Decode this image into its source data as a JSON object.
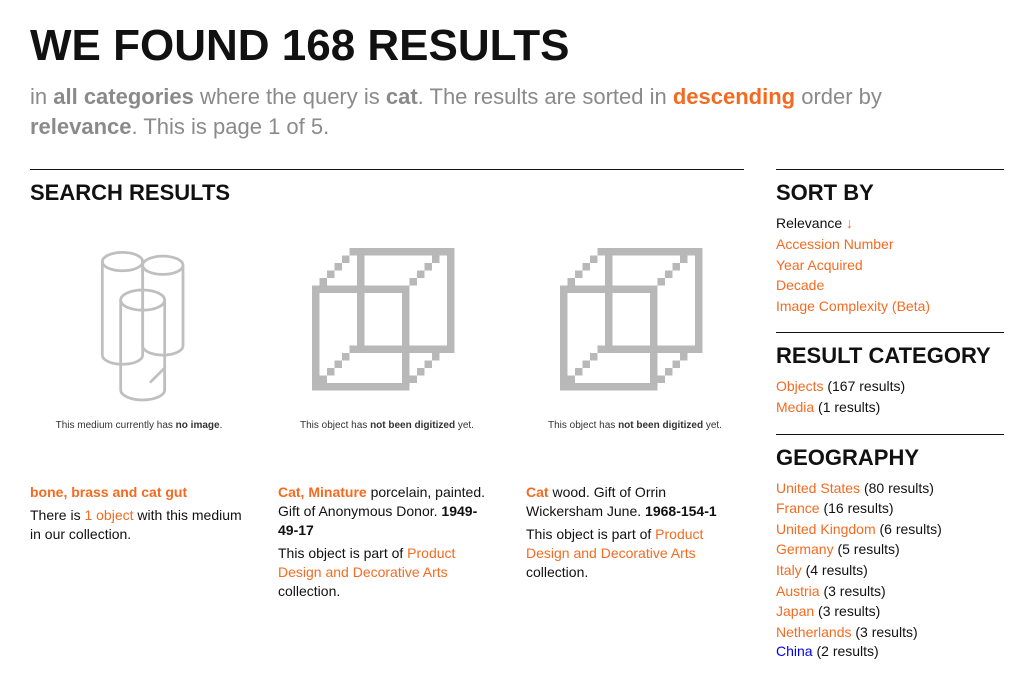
{
  "header": {
    "title": "WE FOUND 168 RESULTS",
    "sub_prefix": "in ",
    "sub_categories": "all categories",
    "sub_where": " where the query is ",
    "sub_query": "cat",
    "sub_after_query": ". The results are sorted in ",
    "sub_order": "descending",
    "sub_by": " order by ",
    "sub_sortkey": "relevance",
    "sub_page": ". This is page 1 of 5."
  },
  "main_heading": "SEARCH RESULTS",
  "cards": [
    {
      "caption_pre": "This medium currently has ",
      "caption_bold": "no image",
      "caption_post": ".",
      "title": "bone, brass and cat gut",
      "desc_pre": "There is ",
      "desc_link": "1 object",
      "desc_post": " with this medium in our collection."
    },
    {
      "caption_pre": "This object has ",
      "caption_bold": "not been digitized",
      "caption_post": " yet.",
      "title": "Cat, Minature",
      "meta": " porcelain, painted. Gift of Anonymous Donor. ",
      "accession": "1949-49-17",
      "collection_pre": "This object is part of ",
      "collection_link": "Product Design and Decorative Arts",
      "collection_post": " collection."
    },
    {
      "caption_pre": "This object has ",
      "caption_bold": "not been digitized",
      "caption_post": " yet.",
      "title": "Cat",
      "meta": " wood. Gift of Orrin Wickersham June. ",
      "accession": "1968-154-1",
      "collection_pre": "This object is part of ",
      "collection_link": "Product Design and Decorative Arts",
      "collection_post": " collection."
    }
  ],
  "sidebar": {
    "sort": {
      "heading": "SORT BY",
      "current": "Relevance",
      "arrow": "↓",
      "options": [
        "Accession Number",
        "Year Acquired",
        "Decade",
        "Image Complexity (Beta)"
      ]
    },
    "result_category": {
      "heading": "RESULT CATEGORY",
      "items": [
        {
          "label": "Objects",
          "count": "(167 results)"
        },
        {
          "label": "Media",
          "count": "(1 results)"
        }
      ]
    },
    "geography": {
      "heading": "GEOGRAPHY",
      "items": [
        {
          "label": "United States",
          "count": "(80 results)"
        },
        {
          "label": "France",
          "count": "(16 results)"
        },
        {
          "label": "United Kingdom",
          "count": "(6 results)"
        },
        {
          "label": "Germany",
          "count": "(5 results)"
        },
        {
          "label": "Italy",
          "count": "(4 results)"
        },
        {
          "label": "Austria",
          "count": "(3 results)"
        },
        {
          "label": "Japan",
          "count": "(3 results)"
        },
        {
          "label": "Netherlands",
          "count": "(3 results)"
        }
      ],
      "cutoff_label": "China",
      "cutoff_count": "(2 results)"
    }
  }
}
